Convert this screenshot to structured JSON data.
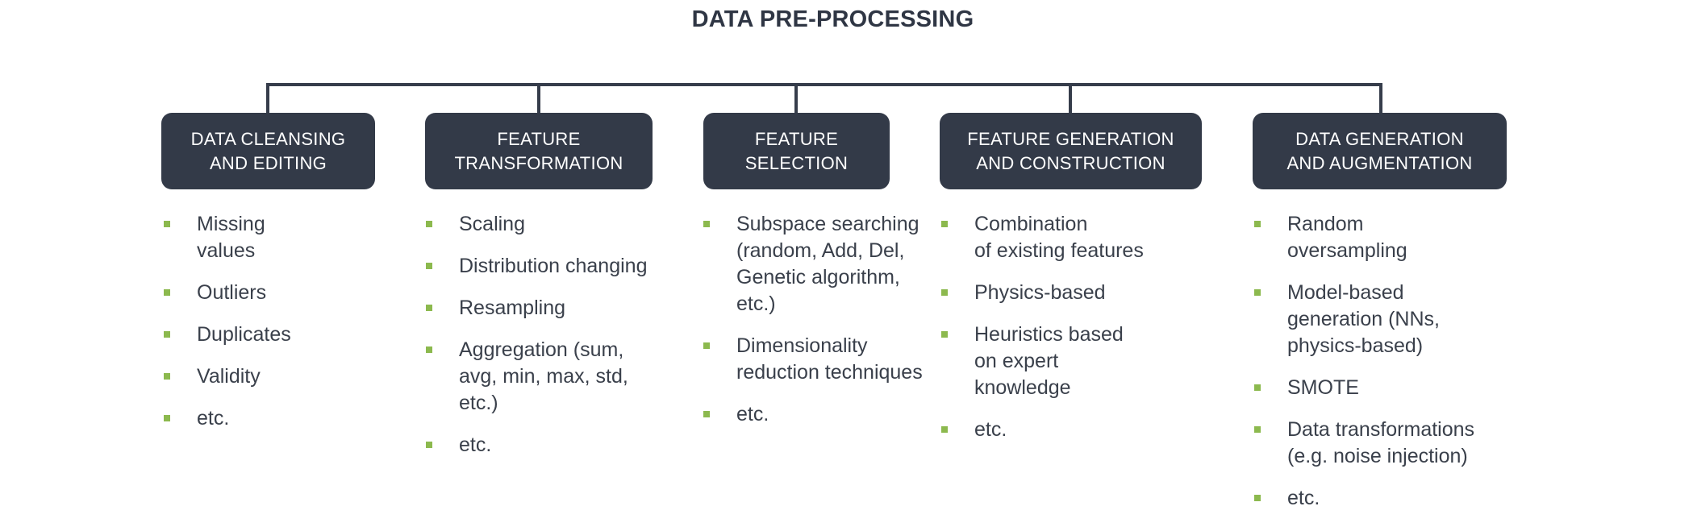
{
  "title": "DATA PRE-PROCESSING",
  "accent_color": "#333a48",
  "bullet_color": "#8cb94e",
  "columns": [
    {
      "heading": [
        "DATA CLEANSING",
        "AND EDITING"
      ],
      "items": [
        [
          "Missing",
          "values"
        ],
        [
          "Outliers"
        ],
        [
          "Duplicates"
        ],
        [
          "Validity"
        ],
        [
          "etc."
        ]
      ]
    },
    {
      "heading": [
        "FEATURE",
        "TRANSFORMATION"
      ],
      "items": [
        [
          "Scaling"
        ],
        [
          "Distribution changing"
        ],
        [
          "Resampling"
        ],
        [
          "Aggregation (sum,",
          "avg, min, max, std,",
          "etc.)"
        ],
        [
          "etc."
        ]
      ]
    },
    {
      "heading": [
        "FEATURE",
        "SELECTION"
      ],
      "items": [
        [
          "Subspace searching",
          "(random, Add, Del,",
          "Genetic algorithm,",
          "etc.)"
        ],
        [
          "Dimensionality",
          "reduction techniques"
        ],
        [
          "etc."
        ]
      ]
    },
    {
      "heading": [
        "FEATURE GENERATION",
        "AND CONSTRUCTION"
      ],
      "items": [
        [
          "Combination",
          "of existing features"
        ],
        [
          "Physics-based"
        ],
        [
          "Heuristics based",
          "on expert",
          "knowledge"
        ],
        [
          "etc."
        ]
      ]
    },
    {
      "heading": [
        "DATA GENERATION",
        "AND AUGMENTATION"
      ],
      "items": [
        [
          "Random",
          "oversampling"
        ],
        [
          "Model-based",
          "generation (NNs,",
          "physics-based)"
        ],
        [
          "SMOTE"
        ],
        [
          "Data transformations",
          "(e.g. noise injection)"
        ],
        [
          "etc."
        ]
      ]
    }
  ]
}
